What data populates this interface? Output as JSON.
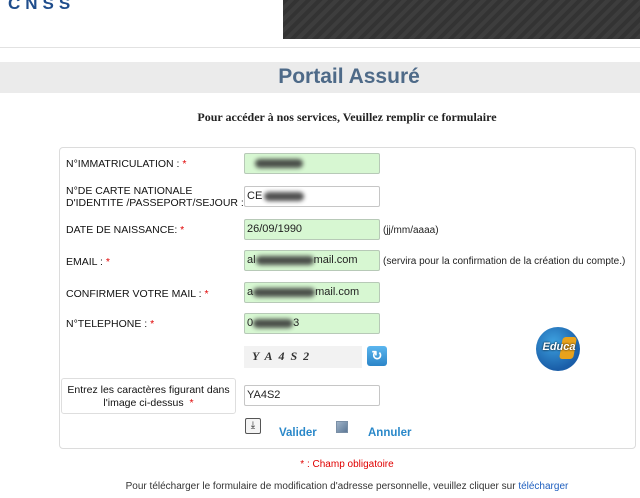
{
  "header": {
    "logo": "CNSS"
  },
  "page": {
    "title": "Portail Assuré",
    "subtitle": "Pour accéder à nos services, Veuillez remplir ce formulaire"
  },
  "form": {
    "required_marker": "*",
    "fields": {
      "immatriculation": {
        "label": "N°IMMATRICULATION :",
        "value": ""
      },
      "carte_nationale": {
        "label_line1": "N°DE CARTE NATIONALE",
        "label_line2": "D'IDENTITE /PASSEPORT/SEJOUR :",
        "value": "CE"
      },
      "date_naissance": {
        "label": "DATE DE NAISSANCE:",
        "value": "26/09/1990",
        "hint": "(jj/mm/aaaa)"
      },
      "email": {
        "label": "EMAIL :",
        "value_start": "al",
        "value_end": "mail.com",
        "hint": "(servira pour la confirmation de la création du compte.)"
      },
      "confirm_email": {
        "label": "CONFIRMER VOTRE MAIL :",
        "value_start": "a",
        "value_end": "mail.com"
      },
      "telephone": {
        "label": "N°TELEPHONE :",
        "value_start": "0",
        "value_end": "3"
      }
    },
    "captcha": {
      "image_text": "YA4S2",
      "prompt_line1": "Entrez les caractères figurant dans",
      "prompt_line2": "l'image ci-dessus",
      "value": "YA4S2"
    },
    "watermark": "Educa",
    "buttons": {
      "validate": "Valider",
      "cancel": "Annuler"
    },
    "required_note": "* : Champ obligatoire"
  },
  "footer": {
    "text": "Pour télécharger le formulaire de modification d'adresse personnelle, veuillez cliquer sur",
    "link": "télécharger"
  }
}
